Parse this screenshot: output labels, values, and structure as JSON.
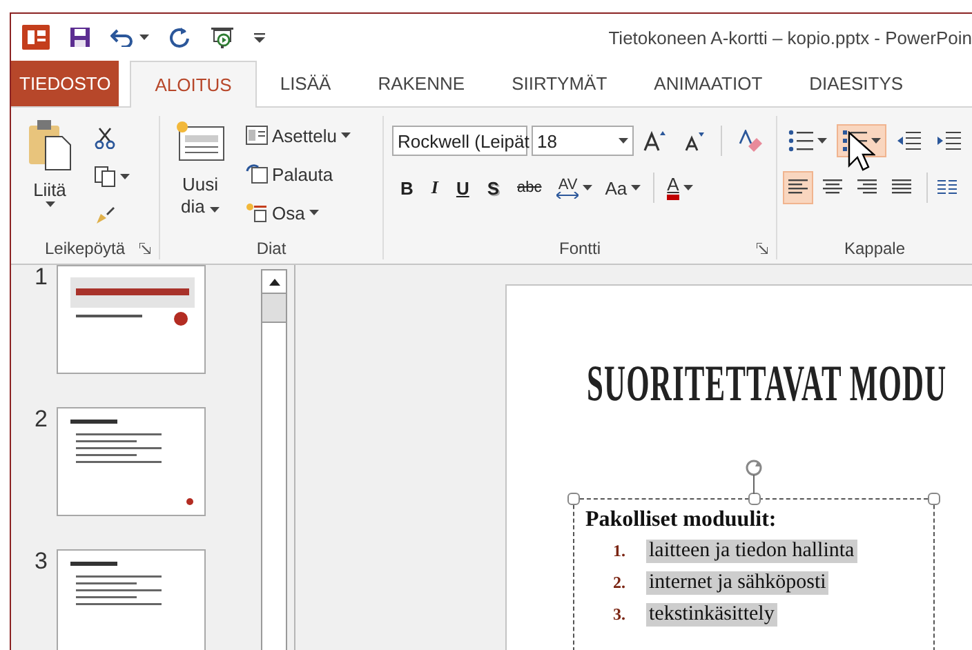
{
  "title": "Tietokoneen A-kortti – kopio.pptx - PowerPoin",
  "tabs": [
    {
      "label": "TIEDOSTO",
      "kind": "file",
      "selected": false
    },
    {
      "label": "ALOITUS",
      "kind": "tab",
      "selected": true
    },
    {
      "label": "LISÄÄ",
      "kind": "tab",
      "selected": false
    },
    {
      "label": "RAKENNE",
      "kind": "tab",
      "selected": false
    },
    {
      "label": "SIIRTYMÄT",
      "kind": "tab",
      "selected": false
    },
    {
      "label": "ANIMAATIOT",
      "kind": "tab",
      "selected": false
    },
    {
      "label": "DIAESITYS",
      "kind": "tab",
      "selected": false
    }
  ],
  "ribbon": {
    "clipboard": {
      "paste_label": "Liitä",
      "group_label": "Leikepöytä"
    },
    "slides": {
      "new_slide_label": "Uusi dia",
      "layout": "Asettelu",
      "reset": "Palauta",
      "section": "Osa",
      "group_label": "Diat"
    },
    "font": {
      "font_name": "Rockwell (Leipät",
      "font_size": "18",
      "styles": [
        {
          "kind": "bold",
          "text": "B"
        },
        {
          "kind": "italic",
          "text": "I"
        },
        {
          "kind": "underline",
          "text": "U"
        },
        {
          "kind": "shadow",
          "text": "S"
        },
        {
          "kind": "strike",
          "text": "abc"
        }
      ],
      "spacing": "AV",
      "change_case": "Aa",
      "color_letter": "A",
      "group_label": "Fontti"
    },
    "paragraph": {
      "lists": [
        {
          "kind": "bullets",
          "selected": false
        },
        {
          "kind": "numbering",
          "selected": true
        }
      ],
      "alignments": [
        {
          "kind": "left",
          "selected": true
        },
        {
          "kind": "center",
          "selected": false
        },
        {
          "kind": "right",
          "selected": false
        },
        {
          "kind": "justify",
          "selected": false
        }
      ],
      "group_label": "Kappale"
    }
  },
  "slides_pane": [
    {
      "number": "1",
      "kind": "title"
    },
    {
      "number": "2",
      "kind": "bullets",
      "logo_mark": true
    },
    {
      "number": "3",
      "kind": "bullets",
      "logo_mark": false
    }
  ],
  "slide": {
    "title": "SUORITETTAVAT MODU",
    "textbox": {
      "heading": "Pakolliset moduulit:",
      "items": [
        {
          "number": "1.",
          "text": "laitteen ja tiedon hallinta",
          "selected": true
        },
        {
          "number": "2.",
          "text": "internet ja sähköposti",
          "selected": true
        },
        {
          "number": "3.",
          "text": "tekstinkäsittely",
          "selected": true
        }
      ]
    }
  }
}
